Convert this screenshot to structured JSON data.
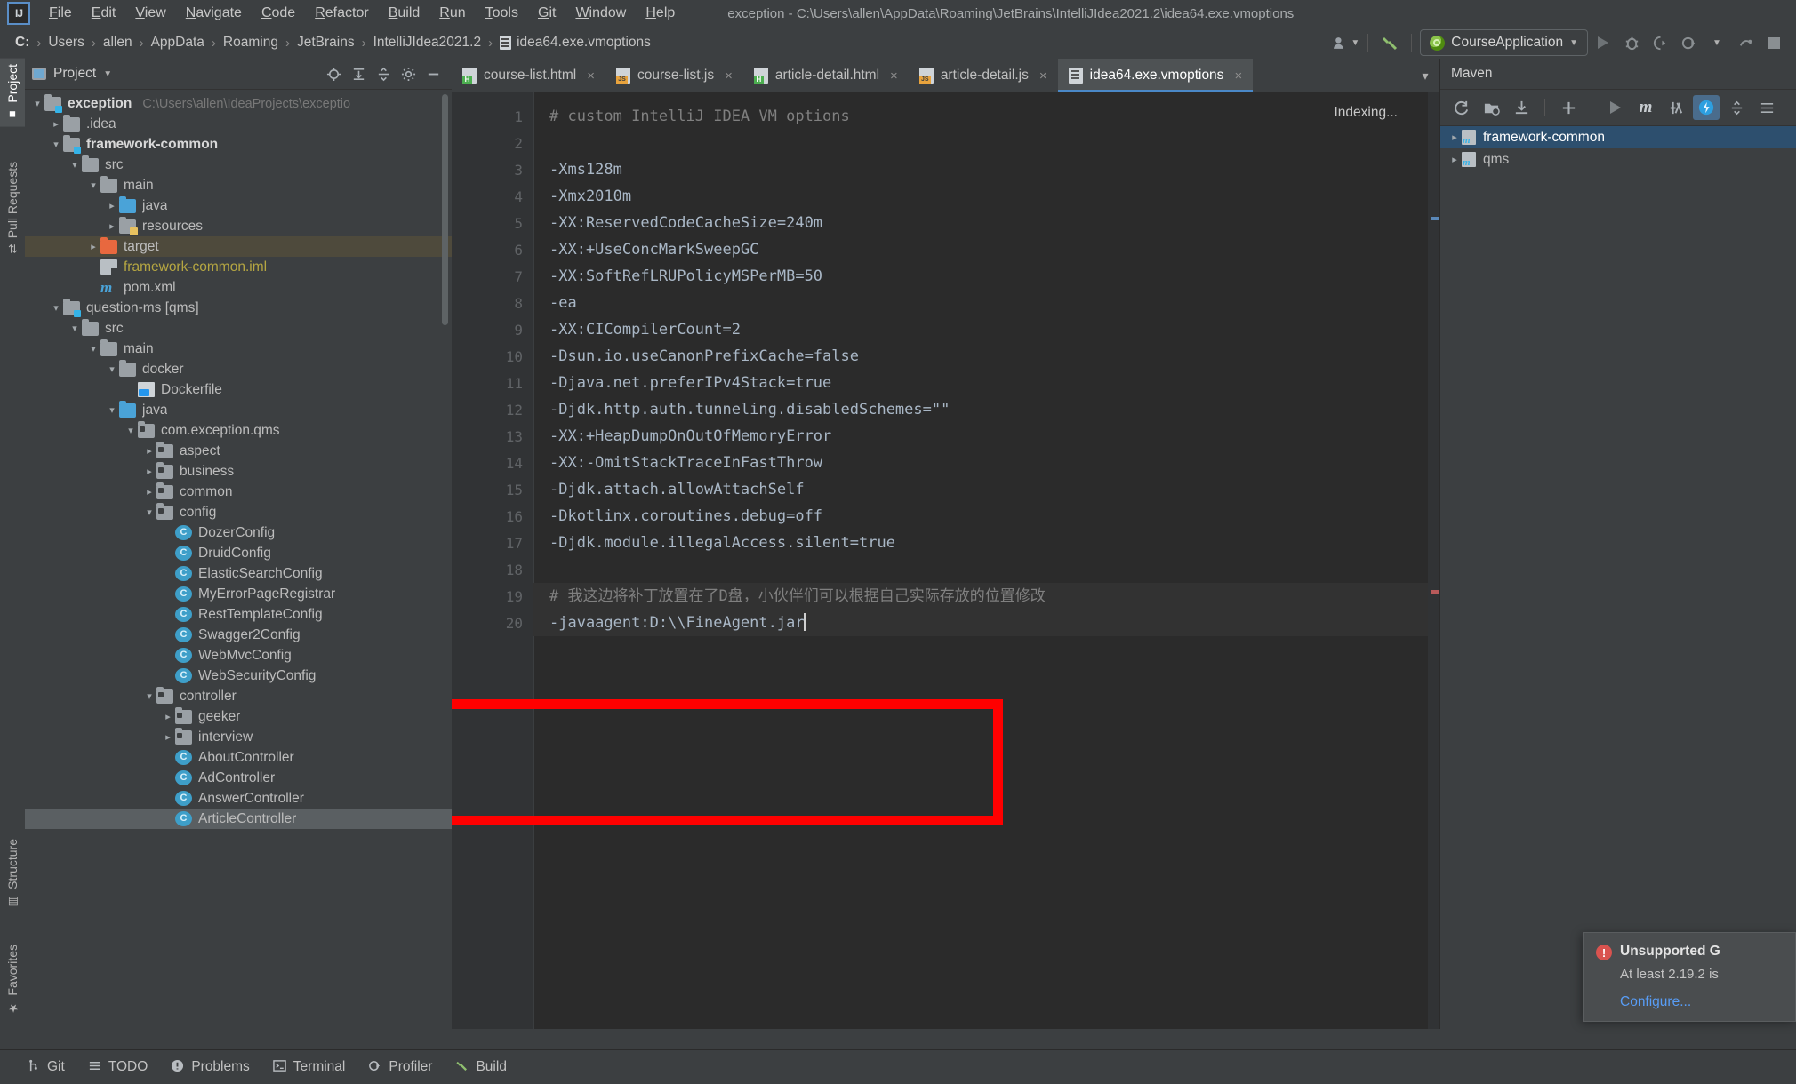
{
  "window": {
    "title": "exception - C:\\Users\\allen\\AppData\\Roaming\\JetBrains\\IntelliJIdea2021.2\\idea64.exe.vmoptions",
    "logo": "IJ"
  },
  "menubar": {
    "items": [
      "File",
      "Edit",
      "View",
      "Navigate",
      "Code",
      "Refactor",
      "Build",
      "Run",
      "Tools",
      "Git",
      "Window",
      "Help"
    ]
  },
  "breadcrumb": {
    "items": [
      "C:",
      "Users",
      "allen",
      "AppData",
      "Roaming",
      "JetBrains",
      "IntelliJIdea2021.2",
      "idea64.exe.vmoptions"
    ],
    "separator": "›"
  },
  "nav_toolbar": {
    "account_icon": "user-icon",
    "build_icon": "hammer-icon",
    "run_config": "CourseApplication",
    "dropdown_caret": "▼",
    "buttons": [
      "run",
      "debug",
      "run-with-coverage",
      "profile",
      "profile-dropdown",
      "attach",
      "stop"
    ]
  },
  "left_tool_strip": {
    "items": [
      {
        "label": "Project",
        "icon": "project-icon",
        "active": true
      },
      {
        "label": "Pull Requests",
        "icon": "pull-request-icon",
        "active": false
      },
      {
        "label": "Structure",
        "icon": "structure-icon",
        "active": false
      },
      {
        "label": "Favorites",
        "icon": "star-icon",
        "active": false
      }
    ]
  },
  "project_panel": {
    "title": "Project",
    "title_caret": "▼",
    "actions": [
      "locate-icon",
      "expand-all-icon",
      "collapse-all-icon",
      "gear-icon",
      "minimize-icon"
    ],
    "tree": [
      {
        "indent": 0,
        "arrow": "v",
        "icon": "folder-module",
        "label": "exception",
        "bold": true,
        "note": "C:\\Users\\allen\\IdeaProjects\\exceptio"
      },
      {
        "indent": 1,
        "arrow": ">",
        "icon": "folder-gray",
        "label": ".idea"
      },
      {
        "indent": 1,
        "arrow": "v",
        "icon": "folder-module",
        "label": "framework-common",
        "bold": true
      },
      {
        "indent": 2,
        "arrow": "v",
        "icon": "folder-gray",
        "label": "src"
      },
      {
        "indent": 3,
        "arrow": "v",
        "icon": "folder-gray",
        "label": "main"
      },
      {
        "indent": 4,
        "arrow": ">",
        "icon": "folder-blue",
        "label": "java"
      },
      {
        "indent": 4,
        "arrow": ">",
        "icon": "folder-res",
        "label": "resources"
      },
      {
        "indent": 3,
        "arrow": ">",
        "icon": "folder-orange",
        "label": "target",
        "highlight": true
      },
      {
        "indent": 3,
        "arrow": "none",
        "icon": "iml-file",
        "label": "framework-common.iml",
        "yellow": true
      },
      {
        "indent": 3,
        "arrow": "none",
        "icon": "maven-m",
        "label": "pom.xml"
      },
      {
        "indent": 1,
        "arrow": "v",
        "icon": "folder-module",
        "label": "question-ms [qms]"
      },
      {
        "indent": 2,
        "arrow": "v",
        "icon": "folder-gray",
        "label": "src"
      },
      {
        "indent": 3,
        "arrow": "v",
        "icon": "folder-gray",
        "label": "main"
      },
      {
        "indent": 4,
        "arrow": "v",
        "icon": "folder-gray",
        "label": "docker"
      },
      {
        "indent": 5,
        "arrow": "none",
        "icon": "docker-file",
        "label": "Dockerfile"
      },
      {
        "indent": 4,
        "arrow": "v",
        "icon": "folder-blue",
        "label": "java"
      },
      {
        "indent": 5,
        "arrow": "v",
        "icon": "folder-pkg",
        "label": "com.exception.qms"
      },
      {
        "indent": 6,
        "arrow": ">",
        "icon": "folder-pkg",
        "label": "aspect"
      },
      {
        "indent": 6,
        "arrow": ">",
        "icon": "folder-pkg",
        "label": "business"
      },
      {
        "indent": 6,
        "arrow": ">",
        "icon": "folder-pkg",
        "label": "common"
      },
      {
        "indent": 6,
        "arrow": "v",
        "icon": "folder-pkg",
        "label": "config"
      },
      {
        "indent": 7,
        "arrow": "none",
        "icon": "class",
        "label": "DozerConfig"
      },
      {
        "indent": 7,
        "arrow": "none",
        "icon": "class",
        "label": "DruidConfig"
      },
      {
        "indent": 7,
        "arrow": "none",
        "icon": "class",
        "label": "ElasticSearchConfig"
      },
      {
        "indent": 7,
        "arrow": "none",
        "icon": "class",
        "label": "MyErrorPageRegistrar"
      },
      {
        "indent": 7,
        "arrow": "none",
        "icon": "class",
        "label": "RestTemplateConfig"
      },
      {
        "indent": 7,
        "arrow": "none",
        "icon": "class",
        "label": "Swagger2Config"
      },
      {
        "indent": 7,
        "arrow": "none",
        "icon": "class",
        "label": "WebMvcConfig"
      },
      {
        "indent": 7,
        "arrow": "none",
        "icon": "class",
        "label": "WebSecurityConfig"
      },
      {
        "indent": 6,
        "arrow": "v",
        "icon": "folder-pkg",
        "label": "controller"
      },
      {
        "indent": 7,
        "arrow": ">",
        "icon": "folder-pkg",
        "label": "geeker"
      },
      {
        "indent": 7,
        "arrow": ">",
        "icon": "folder-pkg",
        "label": "interview"
      },
      {
        "indent": 7,
        "arrow": "none",
        "icon": "class",
        "label": "AboutController"
      },
      {
        "indent": 7,
        "arrow": "none",
        "icon": "class",
        "label": "AdController"
      },
      {
        "indent": 7,
        "arrow": "none",
        "icon": "class",
        "label": "AnswerController"
      },
      {
        "indent": 7,
        "arrow": "none",
        "icon": "class",
        "label": "ArticleController",
        "selected": true
      }
    ]
  },
  "editor": {
    "tabs": [
      {
        "label": "course-list.html",
        "type": "html",
        "active": false
      },
      {
        "label": "course-list.js",
        "type": "js",
        "active": false
      },
      {
        "label": "article-detail.html",
        "type": "html",
        "active": false
      },
      {
        "label": "article-detail.js",
        "type": "js",
        "active": false
      },
      {
        "label": "idea64.exe.vmoptions",
        "type": "vmoptions",
        "active": true
      }
    ],
    "tab_close": "×",
    "tabs_overflow": "⌄",
    "status_text": "Indexing...",
    "lines": [
      {
        "n": 1,
        "text": "# custom IntelliJ IDEA VM options",
        "kind": "comment"
      },
      {
        "n": 2,
        "text": "",
        "kind": "code"
      },
      {
        "n": 3,
        "text": "-Xms128m",
        "kind": "code"
      },
      {
        "n": 4,
        "text": "-Xmx2010m",
        "kind": "code"
      },
      {
        "n": 5,
        "text": "-XX:ReservedCodeCacheSize=240m",
        "kind": "code"
      },
      {
        "n": 6,
        "text": "-XX:+UseConcMarkSweepGC",
        "kind": "code"
      },
      {
        "n": 7,
        "text": "-XX:SoftRefLRUPolicyMSPerMB=50",
        "kind": "code"
      },
      {
        "n": 8,
        "text": "-ea",
        "kind": "code"
      },
      {
        "n": 9,
        "text": "-XX:CICompilerCount=2",
        "kind": "code"
      },
      {
        "n": 10,
        "text": "-Dsun.io.useCanonPrefixCache=false",
        "kind": "code"
      },
      {
        "n": 11,
        "text": "-Djava.net.preferIPv4Stack=true",
        "kind": "code"
      },
      {
        "n": 12,
        "text": "-Djdk.http.auth.tunneling.disabledSchemes=\"\"",
        "kind": "code"
      },
      {
        "n": 13,
        "text": "-XX:+HeapDumpOnOutOfMemoryError",
        "kind": "code"
      },
      {
        "n": 14,
        "text": "-XX:-OmitStackTraceInFastThrow",
        "kind": "code"
      },
      {
        "n": 15,
        "text": "-Djdk.attach.allowAttachSelf",
        "kind": "code"
      },
      {
        "n": 16,
        "text": "-Dkotlinx.coroutines.debug=off",
        "kind": "code"
      },
      {
        "n": 17,
        "text": "-Djdk.module.illegalAccess.silent=true",
        "kind": "code"
      },
      {
        "n": 18,
        "text": "",
        "kind": "code"
      },
      {
        "n": 19,
        "text": "# 我这边将补丁放置在了D盘，小伙伴们可以根据自己实际存放的位置修改",
        "kind": "comment",
        "highlight_row": true
      },
      {
        "n": 20,
        "text": "-javaagent:D:\\\\FineAgent.jar",
        "kind": "code",
        "caret_at_end": true,
        "highlight_row": true
      }
    ],
    "annotation": {
      "shape": "rectangle",
      "color": "#ff0000"
    }
  },
  "maven_panel": {
    "title": "Maven",
    "toolbar": [
      "reload-icon",
      "add-maven-project-icon",
      "download-sources-icon",
      "plus-icon",
      "execute-icon",
      "maven-goal-icon",
      "toggle-skip-tests-icon",
      "toggle-offline-icon",
      "collapse-all-icon",
      "settings-icon"
    ],
    "rows": [
      {
        "arrow": ">",
        "label": "framework-common",
        "selected": true
      },
      {
        "arrow": ">",
        "label": "qms",
        "selected": false
      }
    ]
  },
  "notification": {
    "icon": "error-icon",
    "title": "Unsupported G",
    "body": "At least 2.19.2 is",
    "link": "Configure..."
  },
  "statusbar": {
    "items": [
      {
        "label": "Git",
        "icon": "branch-icon"
      },
      {
        "label": "TODO",
        "icon": "list-icon"
      },
      {
        "label": "Problems",
        "icon": "warning-icon"
      },
      {
        "label": "Terminal",
        "icon": "terminal-icon"
      },
      {
        "label": "Profiler",
        "icon": "profiler-icon"
      },
      {
        "label": "Build",
        "icon": "hammer-icon"
      }
    ]
  },
  "colors": {
    "chrome": "#3c3f41",
    "editor_bg": "#2b2b2b",
    "gutter_bg": "#313335",
    "accent_blue": "#4a88c7",
    "annotation_red": "#ff0000",
    "selection_blue": "#2d4f6e",
    "code_fg": "#a9b7c6",
    "comment_fg": "#808080",
    "link_blue": "#589df6"
  }
}
